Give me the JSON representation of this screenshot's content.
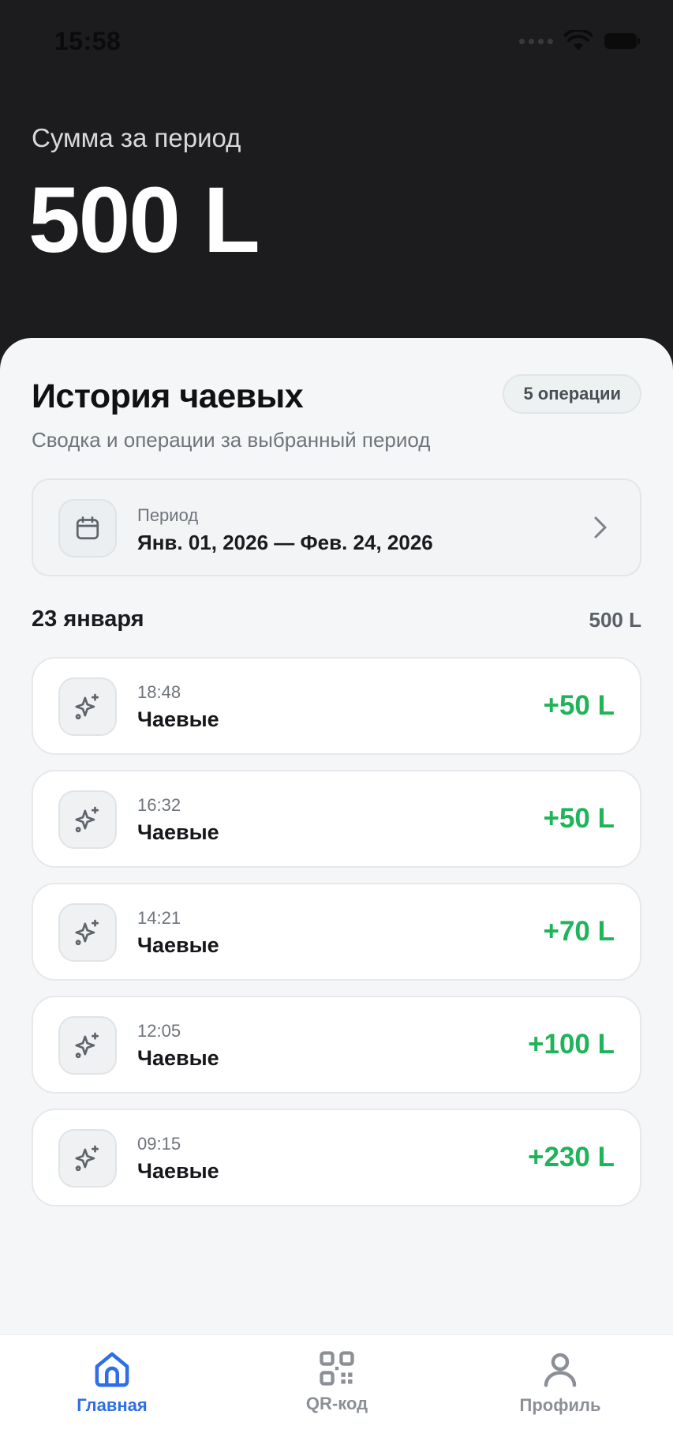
{
  "status_bar": {
    "time": "15:58",
    "icons": [
      "signal-icon",
      "wifi-icon",
      "battery-icon"
    ]
  },
  "hero": {
    "label": "Сумма за период",
    "amount": "500 L"
  },
  "history": {
    "title": "История чаевых",
    "badge": "5 операции",
    "subtitle": "Сводка и операции за выбранный период"
  },
  "period": {
    "label": "Период",
    "range": "Янв. 01, 2026 — Фев. 24, 2026",
    "icon": "calendar-icon",
    "chevron": "chevron-right-icon"
  },
  "day": {
    "title": "23 января",
    "total": "500 L"
  },
  "transactions": [
    {
      "time": "18:48",
      "name": "Чаевые",
      "amount": "+50 L"
    },
    {
      "time": "16:32",
      "name": "Чаевые",
      "amount": "+50 L"
    },
    {
      "time": "14:21",
      "name": "Чаевые",
      "amount": "+70 L"
    },
    {
      "time": "12:05",
      "name": "Чаевые",
      "amount": "+100 L"
    },
    {
      "time": "09:15",
      "name": "Чаевые",
      "amount": "+230 L"
    }
  ],
  "tabs": [
    {
      "label": "Главная",
      "icon": "home-icon",
      "active": true
    },
    {
      "label": "QR-код",
      "icon": "qr-code-icon",
      "active": false
    },
    {
      "label": "Профиль",
      "icon": "profile-icon",
      "active": false
    }
  ],
  "colors": {
    "header_bg": "#1c1c1e",
    "sheet_bg": "#f5f6f8",
    "positive": "#1fb35a",
    "accent": "#2f6ee6",
    "inactive": "#8c9096"
  }
}
